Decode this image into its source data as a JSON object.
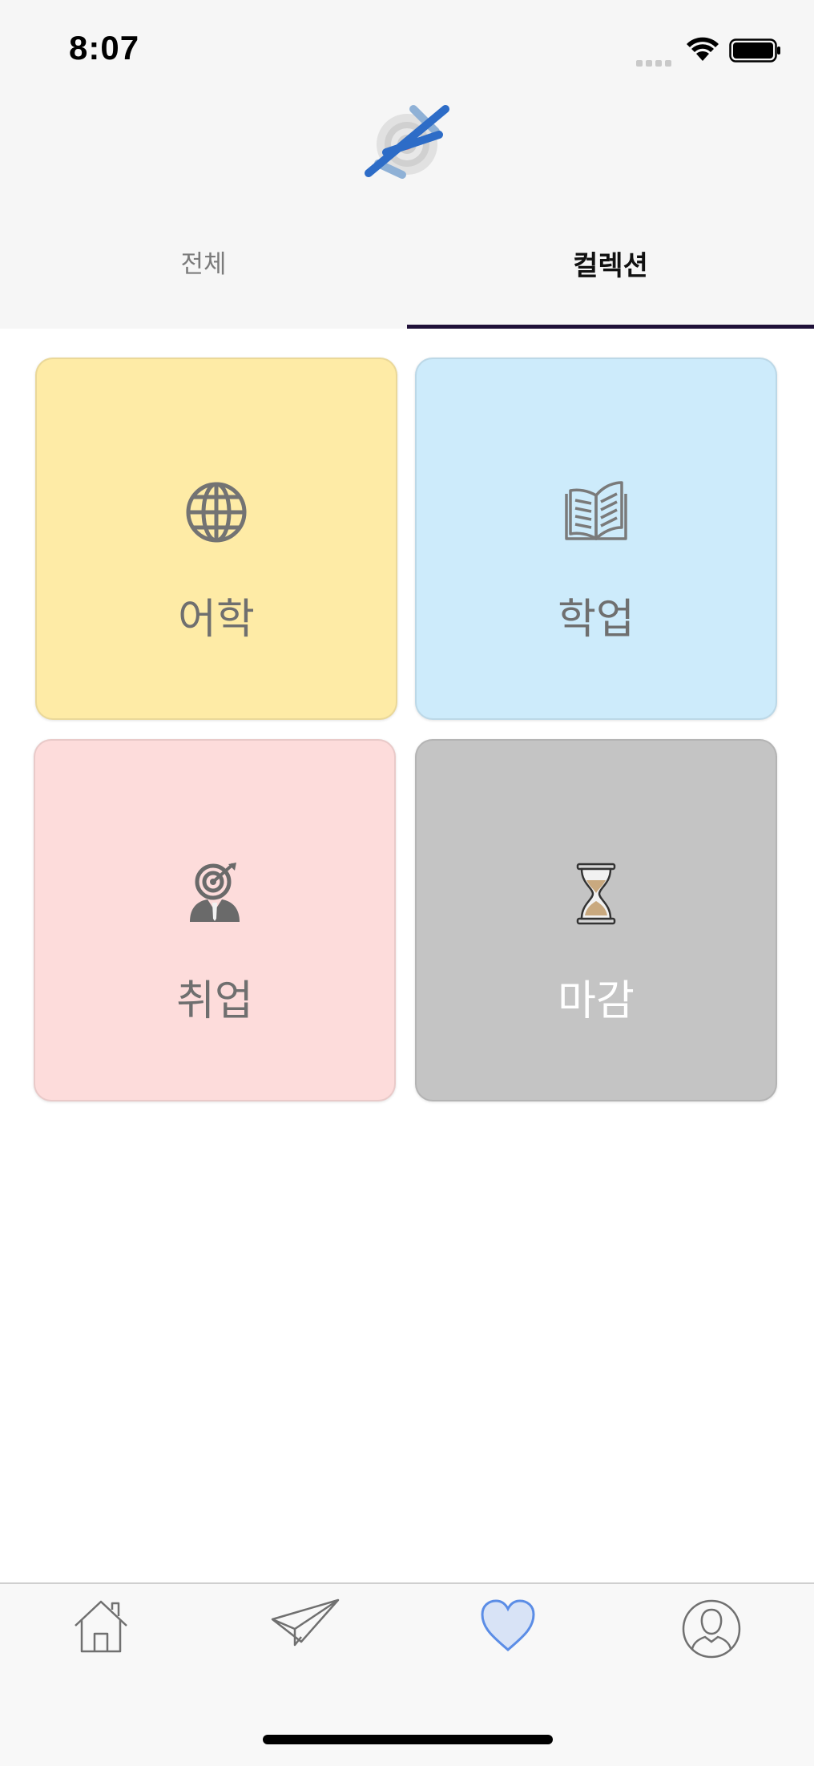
{
  "status_bar": {
    "time": "8:07"
  },
  "tabs": [
    {
      "label": "전체",
      "selected": false
    },
    {
      "label": "컬렉션",
      "selected": true
    }
  ],
  "categories": [
    {
      "label": "어학",
      "icon": "globe-icon",
      "color": "#feeba6"
    },
    {
      "label": "학업",
      "icon": "open-book-icon",
      "color": "#cdebfb"
    },
    {
      "label": "취업",
      "icon": "businessman-target-icon",
      "color": "#fddcdb"
    },
    {
      "label": "마감",
      "icon": "hourglass-icon",
      "color": "#c4c4c4"
    }
  ],
  "bottom_nav": [
    {
      "icon": "home-icon",
      "selected": false
    },
    {
      "icon": "paper-plane-icon",
      "selected": false
    },
    {
      "icon": "heart-icon",
      "selected": true
    },
    {
      "icon": "profile-icon",
      "selected": false
    }
  ],
  "colors": {
    "tab_indicator": "#1f1038",
    "nav_selected": "#5b8de6"
  }
}
